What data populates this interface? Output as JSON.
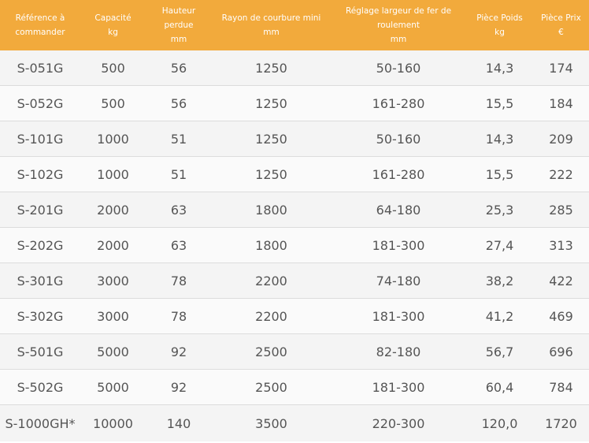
{
  "table": {
    "headers": [
      {
        "line1": "Référence à",
        "line2": "commander"
      },
      {
        "line1": "Capacité",
        "line2": "kg"
      },
      {
        "line1": "Hauteur perdue",
        "line2": "mm"
      },
      {
        "line1": "Rayon de courbure mini",
        "line2": "mm"
      },
      {
        "line1": "Réglage largeur de fer de roulement",
        "line2": "mm"
      },
      {
        "line1": "Pièce Poids",
        "line2": "kg"
      },
      {
        "line1": "Pièce Prix",
        "line2": "€"
      }
    ],
    "rows": [
      [
        "S-051G",
        "500",
        "56",
        "1250",
        "50-160",
        "14,3",
        "174"
      ],
      [
        "S-052G",
        "500",
        "56",
        "1250",
        "161-280",
        "15,5",
        "184"
      ],
      [
        "S-101G",
        "1000",
        "51",
        "1250",
        "50-160",
        "14,3",
        "209"
      ],
      [
        "S-102G",
        "1000",
        "51",
        "1250",
        "161-280",
        "15,5",
        "222"
      ],
      [
        "S-201G",
        "2000",
        "63",
        "1800",
        "64-180",
        "25,3",
        "285"
      ],
      [
        "S-202G",
        "2000",
        "63",
        "1800",
        "181-300",
        "27,4",
        "313"
      ],
      [
        "S-301G",
        "3000",
        "78",
        "2200",
        "74-180",
        "38,2",
        "422"
      ],
      [
        "S-302G",
        "3000",
        "78",
        "2200",
        "181-300",
        "41,2",
        "469"
      ],
      [
        "S-501G",
        "5000",
        "92",
        "2500",
        "82-180",
        "56,7",
        "696"
      ],
      [
        "S-502G",
        "5000",
        "92",
        "2500",
        "181-300",
        "60,4",
        "784"
      ],
      [
        "S-1000GH*",
        "10000",
        "140",
        "3500",
        "220-300",
        "120,0",
        "1720"
      ]
    ]
  },
  "colors": {
    "header_bg": "#f2aa3c",
    "header_text": "#ffffff",
    "cell_text": "#555555",
    "row_divider": "#dcdcdc"
  }
}
